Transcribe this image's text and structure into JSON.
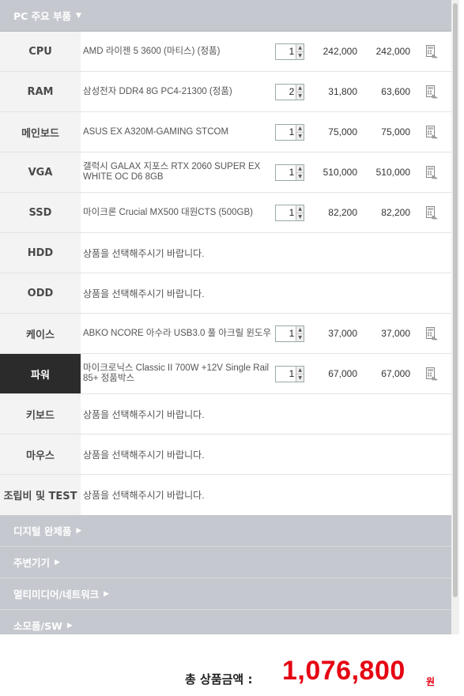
{
  "section_open": {
    "title": "PC 주요 부품",
    "arrow": "▼"
  },
  "rows": [
    {
      "label": "CPU",
      "name": "AMD 라이젠 5 3600 (마티스) (정품)",
      "qty": "1",
      "unit_price": "242,000",
      "total_price": "242,000",
      "selected": true
    },
    {
      "label": "RAM",
      "name": "삼성전자 DDR4 8G PC4-21300 (정품)",
      "qty": "2",
      "unit_price": "31,800",
      "total_price": "63,600",
      "selected": true
    },
    {
      "label": "메인보드",
      "name": "ASUS EX A320M-GAMING STCOM",
      "qty": "1",
      "unit_price": "75,000",
      "total_price": "75,000",
      "selected": true
    },
    {
      "label": "VGA",
      "name": "갤럭시 GALAX 지포스 RTX 2060 SUPER EX WHITE OC D6 8GB",
      "qty": "1",
      "unit_price": "510,000",
      "total_price": "510,000",
      "selected": true
    },
    {
      "label": "SSD",
      "name": "마이크론 Crucial MX500 대원CTS (500GB)",
      "qty": "1",
      "unit_price": "82,200",
      "total_price": "82,200",
      "selected": true
    },
    {
      "label": "HDD",
      "placeholder": "상품을 선택해주시기 바랍니다.",
      "selected": false
    },
    {
      "label": "ODD",
      "placeholder": "상품을 선택해주시기 바랍니다.",
      "selected": false
    },
    {
      "label": "케이스",
      "name": "ABKO NCORE 아수라 USB3.0 풀 아크릴 윈도우",
      "qty": "1",
      "unit_price": "37,000",
      "total_price": "37,000",
      "selected": true
    },
    {
      "label": "파워",
      "name": "마이크로닉스 Classic II 700W +12V Single Rail 85+ 정품박스",
      "qty": "1",
      "unit_price": "67,000",
      "total_price": "67,000",
      "selected": true,
      "active": true
    },
    {
      "label": "키보드",
      "placeholder": "상품을 선택해주시기 바랍니다.",
      "selected": false
    },
    {
      "label": "마우스",
      "placeholder": "상품을 선택해주시기 바랍니다.",
      "selected": false
    },
    {
      "label": "조립비 및 TEST",
      "placeholder": "상품을 선택해주시기 바랍니다.",
      "selected": false
    }
  ],
  "collapsed_sections": [
    {
      "title": "디지털 완제품",
      "arrow": "▶"
    },
    {
      "title": "주변기기",
      "arrow": "▶"
    },
    {
      "title": "멀티미디어/네트워크",
      "arrow": "▶"
    },
    {
      "title": "소모품/SW",
      "arrow": "▶"
    }
  ],
  "total": {
    "label": "총 상품금액 :",
    "value": "1,076,800",
    "unit": "원"
  },
  "icons": {
    "remove": "calculator-icon"
  },
  "colors": {
    "header_bg": "#c6c8cf",
    "total_red": "#e60012",
    "active_label_bg": "#2b2b2b"
  }
}
